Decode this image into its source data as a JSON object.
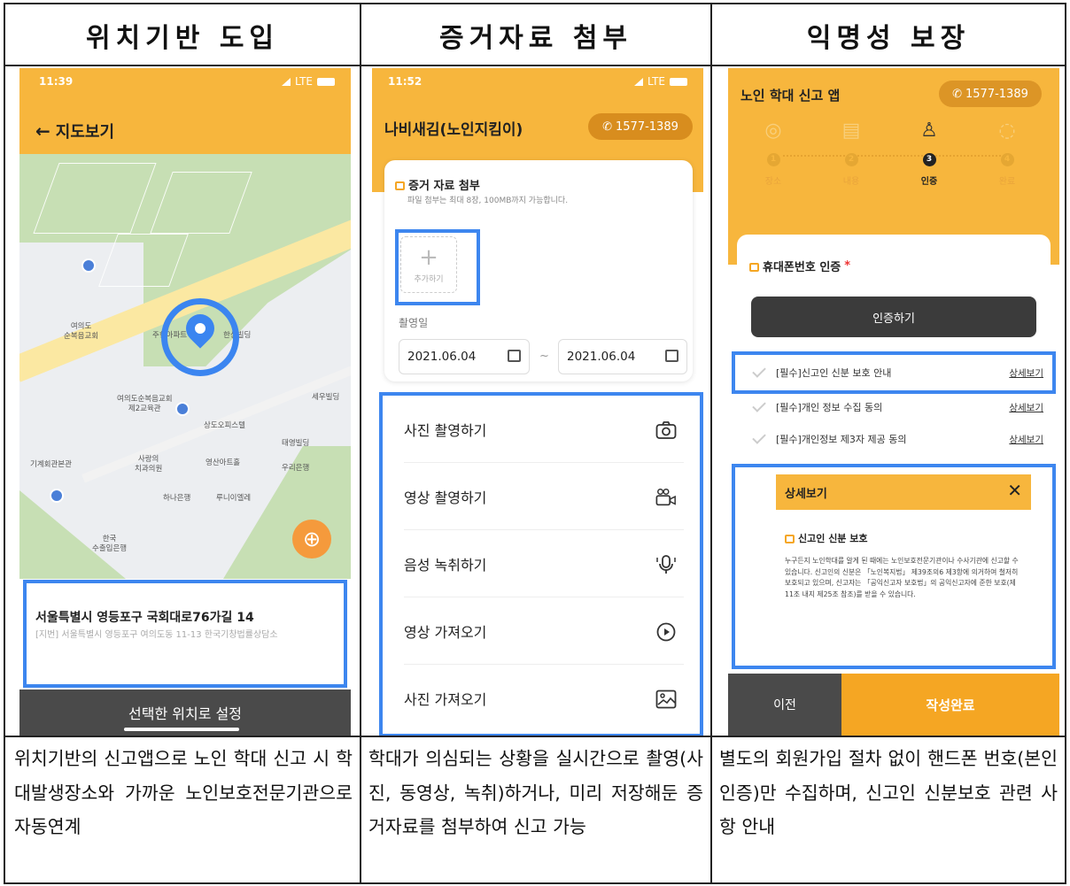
{
  "columns": [
    {
      "heading": "위치기반 도입",
      "caption": "위치기반의 신고앱으로 노인 학대 신고 시 학대발생장소와 가까운 노인보호전문기관으로 자동연계"
    },
    {
      "heading": "증거자료 첨부",
      "caption": "학대가 의심되는 상황을 실시간으로 촬영(사진, 동영상, 녹취)하거나, 미리 저장해둔 증거자료를 첨부하여 신고 가능"
    },
    {
      "heading": "익명성 보장",
      "caption": "별도의 회원가입 절차 없이 핸드폰 번호(본인인증)만 수집하며, 신고인 신분보호 관련 사항 안내"
    }
  ],
  "phone1": {
    "time": "11:39",
    "network": "LTE",
    "title": "지도보기",
    "map_labels": {
      "church": "여의도\n순복음교회",
      "church_annex": "여의도순복음교회\n제2교육관",
      "saewoo": "세우빌딩",
      "sangdo": "상도오피스텔",
      "kigye": "기계회관본관",
      "dental": "사랑의\n치과의원",
      "yeongsan": "영산아트홀",
      "woori": "우리은행",
      "hana": "하나은행",
      "taeyoung": "태영빌딩",
      "kexim": "한국\n수출입은행",
      "jooyoung": "주현아파트",
      "hansin": "한신빌딩",
      "minju": "루니이엘레"
    },
    "address_main": "서울특별시 영등포구 국회대로76가길 14",
    "address_sub": "[지번] 서울특별시 영등포구 여의도동 11-13 한국기창법률상담소",
    "set_button": "선택한 위치로 설정"
  },
  "phone2": {
    "time": "11:52",
    "network": "LTE",
    "title": "나비새김(노인지킴이)",
    "phone_number": "1577-1389",
    "section_title": "증거 자료 첨부",
    "section_sub": "파일 첨부는 최대 8장, 100MB까지 가능합니다.",
    "add_label": "추가하기",
    "date_label": "촬영일",
    "date_from": "2021.06.04",
    "date_to": "2021.06.04",
    "date_sep": "~",
    "menu": [
      {
        "label": "사진 촬영하기",
        "icon": "camera-icon"
      },
      {
        "label": "영상 촬영하기",
        "icon": "video-camera-icon"
      },
      {
        "label": "음성 녹취하기",
        "icon": "microphone-icon"
      },
      {
        "label": "영상 가져오기",
        "icon": "play-icon"
      },
      {
        "label": "사진 가져오기",
        "icon": "image-icon"
      }
    ]
  },
  "phone3": {
    "title": "노인 학대 신고 앱",
    "phone_number": "1577-1389",
    "steps": [
      {
        "num": "1",
        "label": "장소",
        "icon": "location-icon"
      },
      {
        "num": "2",
        "label": "내용",
        "icon": "document-icon"
      },
      {
        "num": "3",
        "label": "인증",
        "icon": "user-check-icon"
      },
      {
        "num": "4",
        "label": "완료",
        "icon": "check-circle-icon"
      }
    ],
    "active_step": 3,
    "auth_title": "휴대폰번호 인증",
    "auth_required_mark": "*",
    "auth_button": "인증하기",
    "agreements": [
      {
        "label": "[필수]신고인 신분 보호 안내",
        "link": "상세보기"
      },
      {
        "label": "[필수]개인 정보 수집 동의",
        "link": "상세보기"
      },
      {
        "label": "[필수]개인정보 제3자 제공 동의",
        "link": "상세보기"
      }
    ],
    "modal_title": "상세보기",
    "modal_close": "✕",
    "modal_subtitle": "신고인 신분 보호",
    "modal_text": "누구든지 노인학대를 알게 된 때에는 노인보호전문기관이나 수사기관에 신고할 수 있습니다. 신고인의 신분은 「노인복지법」 제39조의6 제3항에 의거하여 철저히 보호되고 있으며, 신고자는 「공익신고자 보호법」의 공익신고자에 준한 보호(제11조 내지 제25조 참조)를 받을 수 있습니다.",
    "prev_button": "이전",
    "done_button": "작성완료"
  },
  "colors": {
    "accent": "#f7b63d",
    "highlight": "#3d86ef",
    "dark_button": "#4a4a4a",
    "done_button": "#f5a623"
  }
}
